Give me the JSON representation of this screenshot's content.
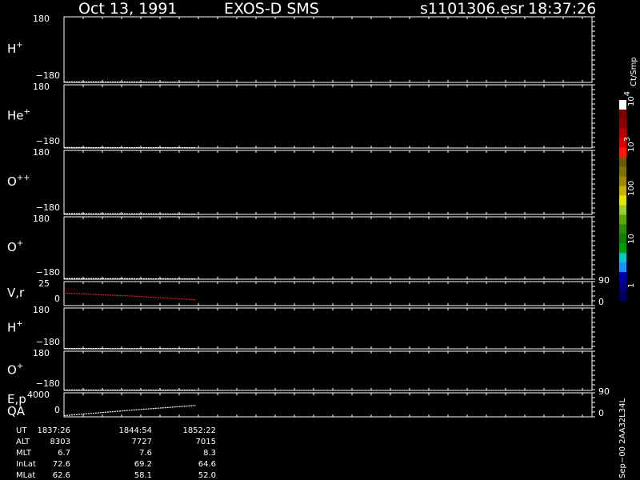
{
  "header": {
    "date": "Oct 13, 1991",
    "instrument": "EXOS-D SMS",
    "file": "s1101306.esr",
    "time": "18:37:26"
  },
  "colorbar": {
    "label": "Ct/Smp",
    "ticks": [
      "10",
      "10",
      "100",
      "10",
      "1"
    ],
    "tick_exponents": [
      "4",
      "3",
      "",
      "",
      ""
    ],
    "colors": [
      "#ffffff",
      "#7a0000",
      "#8e0000",
      "#b40000",
      "#e00000",
      "#ff1a00",
      "#6b5a00",
      "#807000",
      "#a08800",
      "#c8b400",
      "#e6e600",
      "#9acd32",
      "#5aa800",
      "#2e8b00",
      "#108000",
      "#00a000",
      "#00c8c8",
      "#1e90ff",
      "#0000aa",
      "#000080",
      "#00005a"
    ]
  },
  "panels": [
    {
      "id": "h-plus",
      "label": "H",
      "sup": "+",
      "ytop": "180",
      "ybottom": "−180"
    },
    {
      "id": "he-plus",
      "label": "He",
      "sup": "+",
      "ytop": "180",
      "ybottom": "−180"
    },
    {
      "id": "o-plusplus",
      "label": "O",
      "sup": "++",
      "ytop": "180",
      "ybottom": "−180"
    },
    {
      "id": "o-plus",
      "label": "O",
      "sup": "+",
      "ytop": "180",
      "ybottom": "−180"
    },
    {
      "id": "vr",
      "label": "V,r",
      "sup": "",
      "ytop": "25",
      "ybottom": "0",
      "right_top": "90",
      "right_bottom": "0"
    },
    {
      "id": "h-plus-2",
      "label": "H",
      "sup": "+",
      "ytop": "180",
      "ybottom": "−180"
    },
    {
      "id": "o-plus-2",
      "label": "O",
      "sup": "+",
      "ytop": "180",
      "ybottom": "−180"
    },
    {
      "id": "ep-qa",
      "label": "E,p",
      "label2": "QA",
      "sup": "",
      "ytop": "4000",
      "ybottom": "0",
      "right_top": "90",
      "right_bottom": "0"
    }
  ],
  "footer": {
    "rows": [
      {
        "label": "UT",
        "values": [
          "1837:26",
          "1844:54",
          "1852:22"
        ]
      },
      {
        "label": "ALT",
        "values": [
          "8303",
          "7727",
          "7015"
        ]
      },
      {
        "label": "MLT",
        "values": [
          "6.7",
          "7.6",
          "8.3"
        ]
      },
      {
        "label": "InLat",
        "values": [
          "72.6",
          "69.2",
          "64.6"
        ]
      },
      {
        "label": "MLat",
        "values": [
          "62.6",
          "58.1",
          "52.0"
        ]
      }
    ],
    "version": "Sep−00 2AA32L34L"
  },
  "chart_data": {
    "type": "line",
    "title": "Oct 13, 1991   EXOS-D SMS",
    "x": [
      "1837:26",
      "1844:54",
      "1852:22"
    ],
    "series": [
      {
        "name": "H+",
        "values": [
          -177,
          -178,
          -179
        ]
      },
      {
        "name": "He+",
        "values": [
          -177,
          -178,
          -178
        ]
      },
      {
        "name": "O++",
        "values": [
          -176,
          -177,
          -178
        ]
      },
      {
        "name": "O+",
        "values": [
          -176,
          -177,
          -178
        ]
      },
      {
        "name": "V,r",
        "values": [
          13,
          10,
          6
        ]
      },
      {
        "name": "H+",
        "values": [
          -177,
          -178,
          -178
        ]
      },
      {
        "name": "O+",
        "values": [
          -176,
          -177,
          -177
        ]
      },
      {
        "name": "E,p",
        "values": [
          200,
          1100,
          1900
        ]
      }
    ],
    "ylim_angle": [
      -180,
      180
    ],
    "ylim_vr": [
      0,
      25
    ],
    "ylim_ep": [
      0,
      4000
    ]
  }
}
